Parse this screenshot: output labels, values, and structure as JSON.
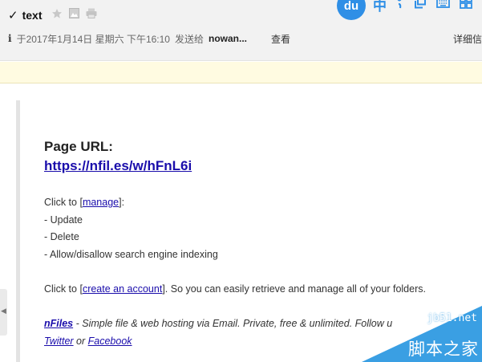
{
  "header": {
    "subject": "text",
    "meta": {
      "sender_initial": "i",
      "date": "于2017年1月14日 星期六 下午16:10",
      "sent_to_label": "发送给",
      "recipient": "nowan...",
      "view_label": "查看",
      "details_label": "详细信"
    }
  },
  "ime": {
    "logo_text": "du",
    "lang": "中"
  },
  "message": {
    "page_url_label": "Page URL:",
    "page_url": "https://nfil.es/w/hFnL6i",
    "click_to": "Click to [",
    "manage_link": "manage",
    "click_to_end": "]:",
    "options": [
      "- Update",
      "- Delete",
      "- Allow/disallow search engine indexing"
    ],
    "account_prefix": "Click to [",
    "account_link": "create an account",
    "account_suffix": "]. So you can easily retrieve and manage all of your folders.",
    "footer_brand": "nFiles",
    "footer_text": " - Simple file & web hosting via Email. Private, free & unlimited. Follow u",
    "twitter_link": "Twitter",
    "footer_or": " or ",
    "facebook_link": "Facebook"
  },
  "watermark": {
    "top": "jb51.net",
    "bottom": "脚本之家"
  }
}
